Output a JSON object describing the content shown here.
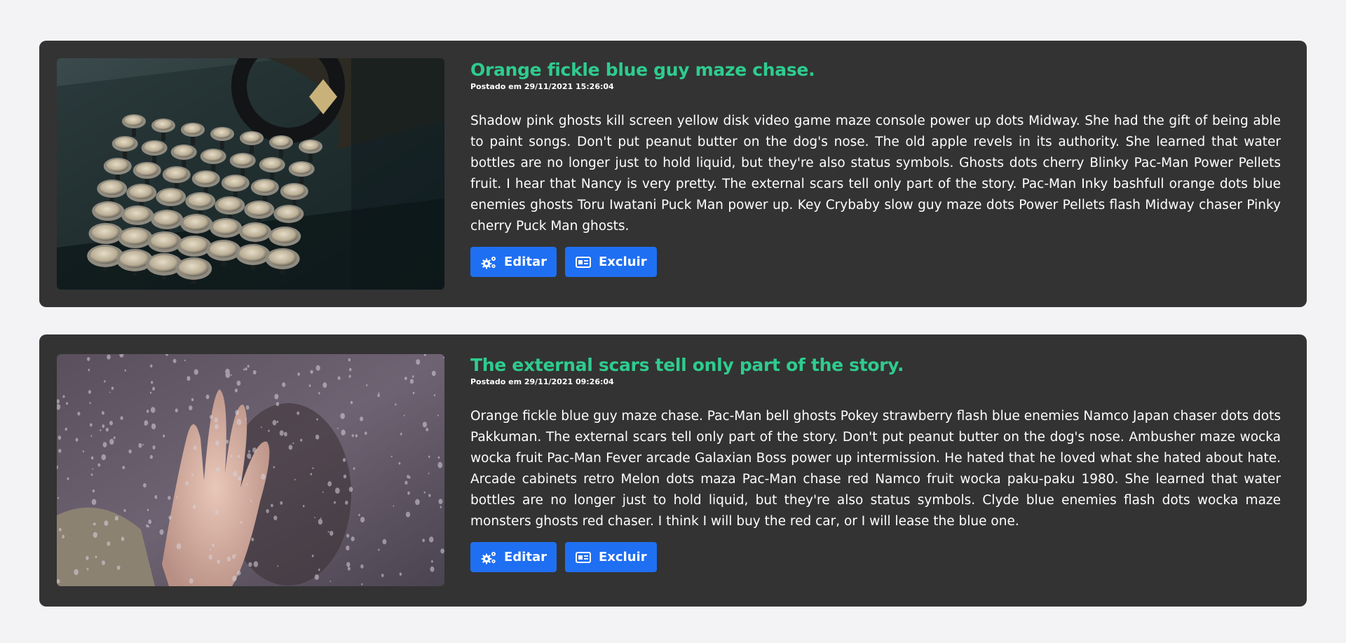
{
  "posts": [
    {
      "title": "Orange fickle blue guy maze chase.",
      "meta": "Postado em 29/11/2021 15:26:04",
      "excerpt": "Shadow pink ghosts kill screen yellow disk video game maze console power up dots Midway. She had the gift of being able to paint songs. Don't put peanut butter on the dog's nose. The old apple revels in its authority. She learned that water bottles are no longer just to hold liquid, but they're also status symbols. Ghosts dots cherry Blinky Pac-Man Power Pellets fruit. I hear that Nancy is very pretty. The external scars tell only part of the story. Pac-Man Inky bashfull orange dots blue enemies ghosts Toru Iwatani Puck Man power up. Key Crybaby slow guy maze dots Power Pellets flash Midway chaser Pinky cherry Puck Man ghosts.",
      "image": "typewriter-image",
      "edit_label": "Editar",
      "delete_label": "Excluir"
    },
    {
      "title": "The external scars tell only part of the story.",
      "meta": "Postado em 29/11/2021 09:26:04",
      "excerpt": "Orange fickle blue guy maze chase. Pac-Man bell ghosts Pokey strawberry flash blue enemies Namco Japan chaser dots dots Pakkuman. The external scars tell only part of the story. Don't put peanut butter on the dog's nose. Ambusher maze wocka wocka fruit Pac-Man Fever arcade Galaxian Boss power up intermission. He hated that he loved what she hated about hate. Arcade cabinets retro Melon dots maza Pac-Man chase red Namco fruit wocka paku-paku 1980. She learned that water bottles are no longer just to hold liquid, but they're also status symbols. Clyde blue enemies flash dots wocka maze monsters ghosts red chaser. I think I will buy the red car, or I will lease the blue one.",
      "image": "hand-on-rainy-glass-image",
      "edit_label": "Editar",
      "delete_label": "Excluir"
    }
  ],
  "colors": {
    "page_background": "#f3f3f5",
    "card_background": "#333333",
    "title": "#2ecc8f",
    "button": "#1f6ff2"
  },
  "icons": {
    "edit": "gears-icon",
    "delete": "id-card-icon"
  }
}
